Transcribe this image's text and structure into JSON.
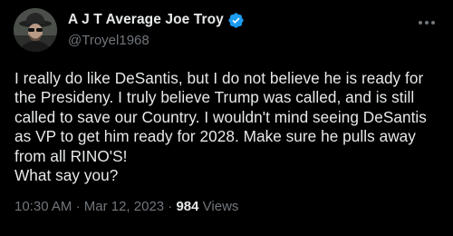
{
  "author": {
    "display_name": "A J T Average Joe Troy",
    "handle": "@Troyel1968",
    "verified": true,
    "verified_color": "#1d9bf0"
  },
  "tweet": {
    "text": "I really do like DeSantis, but I do not believe he is ready for the Presideny. I truly believe Trump was called, and is still called to save our Country. I wouldn't mind seeing DeSantis as VP to get him ready for 2028. Make sure he pulls away from all RINO'S!\nWhat say you?"
  },
  "meta": {
    "time": "10:30 AM",
    "separator": "·",
    "date": "Mar 12, 2023",
    "views_count": "984",
    "views_label": "Views"
  },
  "icons": {
    "verified": "verified-badge-icon",
    "more": "more-options-icon"
  },
  "colors": {
    "background": "#000000",
    "text": "#e7e9ea",
    "secondary": "#71767b"
  }
}
